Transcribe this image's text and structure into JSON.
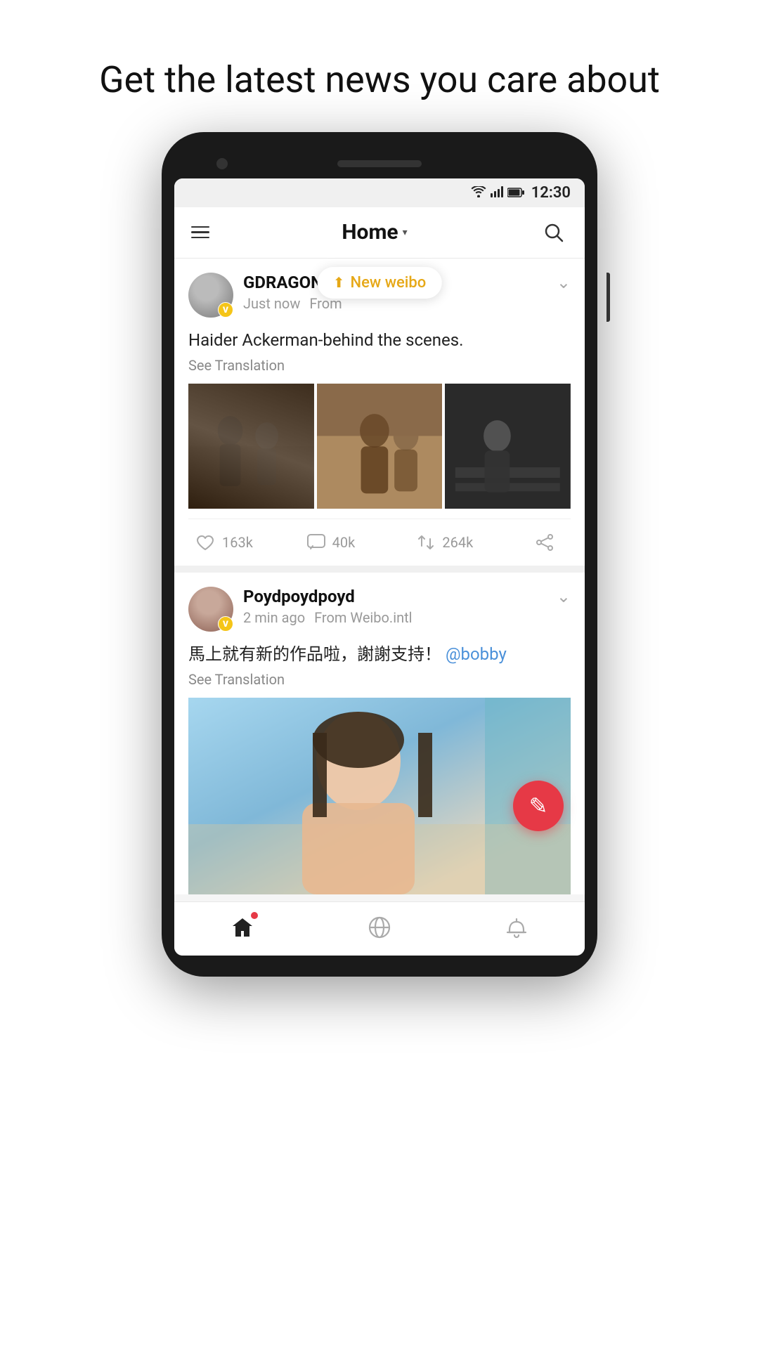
{
  "page": {
    "headline": "Get the latest news you care about"
  },
  "status_bar": {
    "time": "12:30"
  },
  "app_bar": {
    "menu_label": "Menu",
    "title": "Home",
    "dropdown_symbol": "▾",
    "search_label": "Search"
  },
  "new_weibo_toast": {
    "label": "New weibo"
  },
  "posts": [
    {
      "id": "post1",
      "username": "GDRAGON",
      "timestamp": "Just now",
      "source": "From",
      "verified": true,
      "text": "Haider Ackerman-behind the scenes.",
      "see_translation": "See Translation",
      "images": [
        "gd-scene-1",
        "gd-scene-2",
        "gd-scene-3"
      ],
      "likes": "163k",
      "comments": "40k",
      "reposts": "264k"
    },
    {
      "id": "post2",
      "username": "Poydpoydpoyd",
      "timestamp": "2 min ago",
      "source": "From Weibo.intl",
      "verified": true,
      "text": "馬上就有新的作品啦，謝謝支持！",
      "mention": "@bobby",
      "see_translation": "See Translation",
      "images": [
        "poyd-photo-1"
      ]
    }
  ],
  "fab": {
    "label": "Compose"
  },
  "bottom_nav": {
    "items": [
      {
        "id": "home",
        "label": "Home",
        "active": true
      },
      {
        "id": "explore",
        "label": "Explore",
        "active": false
      },
      {
        "id": "notifications",
        "label": "Notifications",
        "active": false
      }
    ]
  }
}
